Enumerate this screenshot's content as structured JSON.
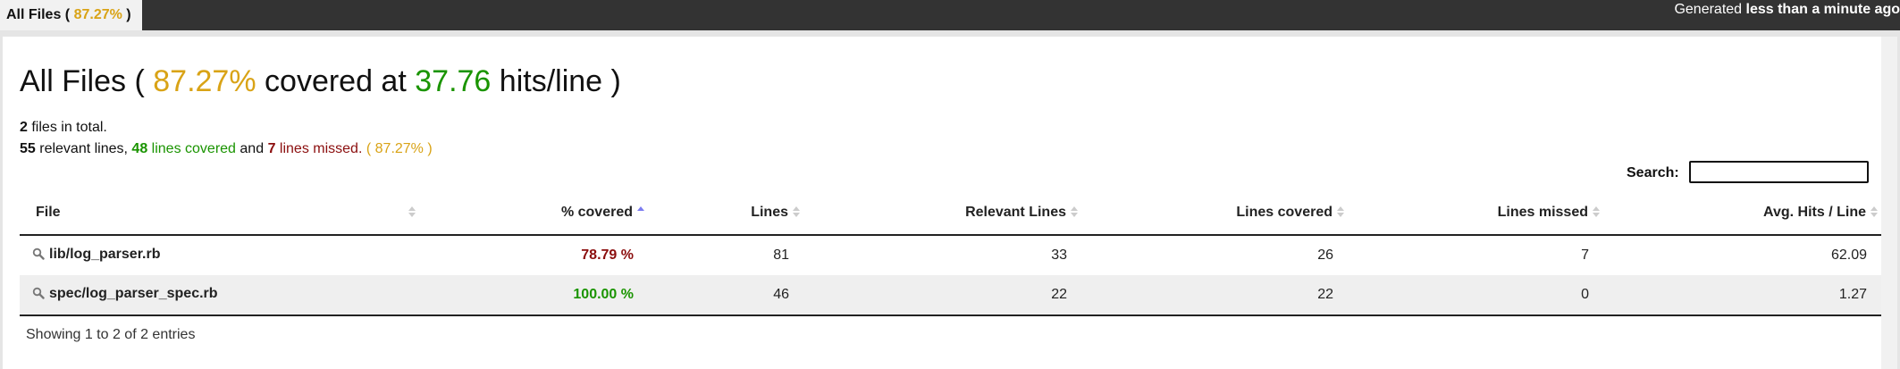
{
  "tab": {
    "label_prefix": "All Files (",
    "percent": "87.27%",
    "label_suffix": ")"
  },
  "generated": {
    "prefix": "Generated",
    "value": "less than a minute ago"
  },
  "heading": {
    "prefix": "All Files (",
    "percent": "87.27%",
    "middle": "covered at",
    "hits": "37.76",
    "suffix": "hits/line )"
  },
  "summary": {
    "files_count": "2",
    "files_text": "files in total.",
    "relevant_count": "55",
    "relevant_text": "relevant lines,",
    "covered_count": "48",
    "covered_text": "lines covered",
    "and_text": "and",
    "missed_count": "7",
    "missed_text": "lines missed.",
    "percent_open": "(",
    "percent": "87.27%",
    "percent_close": ")"
  },
  "search": {
    "label": "Search:",
    "value": ""
  },
  "table": {
    "headers": [
      "File",
      "% covered",
      "Lines",
      "Relevant Lines",
      "Lines covered",
      "Lines missed",
      "Avg. Hits / Line"
    ],
    "rows": [
      {
        "file": "lib/log_parser.rb",
        "covered": "78.79 %",
        "lines": "81",
        "relevant": "33",
        "lines_covered": "26",
        "missed": "7",
        "avg": "62.09"
      },
      {
        "file": "spec/log_parser_spec.rb",
        "covered": "100.00 %",
        "lines": "46",
        "relevant": "22",
        "lines_covered": "22",
        "missed": "0",
        "avg": "1.27"
      }
    ]
  },
  "info": "Showing 1 to 2 of 2 entries",
  "colors": {
    "topbar": "#333333",
    "yellow": "#d9a316",
    "green": "#1a9400",
    "red": "#8b0e0e",
    "sort_active": "#7d7df0"
  },
  "icons": {
    "file_icon": "magnifier-icon",
    "sort_icon": "sort-arrows-icon"
  }
}
